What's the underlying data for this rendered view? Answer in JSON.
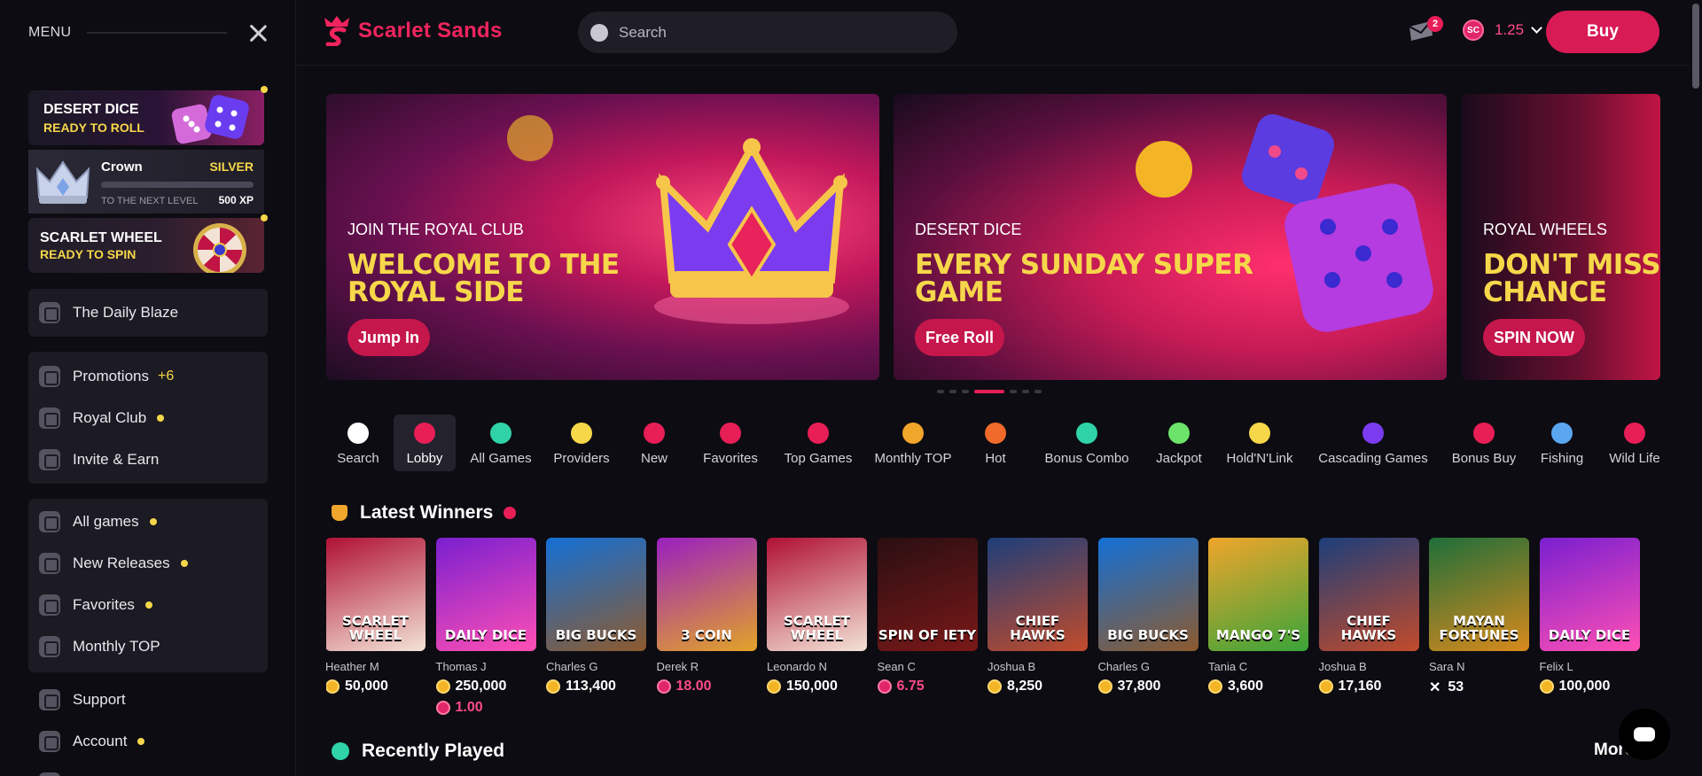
{
  "sidebar": {
    "menu_label": "MENU",
    "promos": {
      "dice": {
        "title": "DESERT DICE",
        "subtitle": "READY TO ROLL"
      },
      "crown": {
        "name": "Crown",
        "level": "SILVER",
        "next": "TO THE NEXT LEVEL",
        "xp": "500 XP",
        "progress": 0.0
      },
      "wheel": {
        "title": "SCARLET WHEEL",
        "subtitle": "READY TO SPIN"
      }
    },
    "daily": "The Daily Blaze",
    "group1": [
      {
        "label": "Promotions",
        "badge": "+6"
      },
      {
        "label": "Royal Club"
      },
      {
        "label": "Invite & Earn"
      }
    ],
    "group2": [
      {
        "label": "All games"
      },
      {
        "label": "New Releases"
      },
      {
        "label": "Favorites"
      },
      {
        "label": "Monthly TOP"
      }
    ],
    "support": "Support",
    "account": "Account"
  },
  "header": {
    "brand": "Scarlet Sands",
    "search_placeholder": "Search",
    "mail_count": "2",
    "currency_code": "SC",
    "balance": "1.25",
    "buy_label": "Buy"
  },
  "banners": [
    {
      "kicker": "JOIN THE ROYAL CLUB",
      "headline": "WELCOME TO THE ROYAL SIDE",
      "cta": "Jump In"
    },
    {
      "kicker": "DESERT DICE",
      "headline": "EVERY SUNDAY SUPER GAME",
      "cta": "Free Roll"
    },
    {
      "kicker": "ROYAL WHEELS",
      "headline": "DON'T MISS YOUR CHANCE",
      "cta": "SPIN NOW"
    }
  ],
  "categories": [
    {
      "label": "Search",
      "icon": "search-icon",
      "color": "#ffffff"
    },
    {
      "label": "Lobby",
      "icon": "lobby-icon",
      "color": "#e81e57"
    },
    {
      "label": "All Games",
      "icon": "gamepad-icon",
      "color": "#2fd3a7"
    },
    {
      "label": "Providers",
      "icon": "star-icon",
      "color": "#f6d74a"
    },
    {
      "label": "New",
      "icon": "new-icon",
      "color": "#e81e57"
    },
    {
      "label": "Favorites",
      "icon": "heart-icon",
      "color": "#e81e57"
    },
    {
      "label": "Top Games",
      "icon": "rocket-icon",
      "color": "#e81e57"
    },
    {
      "label": "Monthly TOP",
      "icon": "medal-icon",
      "color": "#f0a52b"
    },
    {
      "label": "Hot",
      "icon": "flame-icon",
      "color": "#f06a2b"
    },
    {
      "label": "Bonus Combo",
      "icon": "bomb-icon",
      "color": "#2fd3a7"
    },
    {
      "label": "Jackpot",
      "icon": "jackpot-icon",
      "color": "#6ce36a"
    },
    {
      "label": "Hold'N'Link",
      "icon": "coins-icon",
      "color": "#f6d74a"
    },
    {
      "label": "Cascading Games",
      "icon": "cascade-icon",
      "color": "#7b3cf0"
    },
    {
      "label": "Bonus Buy",
      "icon": "bag-icon",
      "color": "#e81e57"
    },
    {
      "label": "Fishing",
      "icon": "fish-icon",
      "color": "#5aa7f0"
    },
    {
      "label": "Wild Life",
      "icon": "wildlife-icon",
      "color": "#e81e57"
    }
  ],
  "latest_winners": {
    "title": "Latest Winners",
    "items": [
      {
        "game": "SCARLET WHEEL",
        "player": "Heather M",
        "prize": "50,000",
        "coin": "gold",
        "colorA": "#b01035",
        "colorB": "#f3e3d6"
      },
      {
        "game": "DAILY DICE",
        "player": "Thomas J",
        "prize": "250,000",
        "prize2": "1.00",
        "coin": "gold",
        "colorA": "#7a1fd0",
        "colorB": "#ff4fb4"
      },
      {
        "game": "BIG BUCKS",
        "player": "Charles G",
        "prize": "113,400",
        "coin": "gold",
        "colorA": "#1470d6",
        "colorB": "#8d5a2d"
      },
      {
        "game": "3 COIN",
        "player": "Derek R",
        "prize": "18.00",
        "coin": "sc",
        "colorA": "#9a1fc0",
        "colorB": "#e2a428"
      },
      {
        "game": "SCARLET WHEEL",
        "player": "Leonardo N",
        "prize": "150,000",
        "coin": "gold",
        "colorA": "#b01035",
        "colorB": "#f3e3d6"
      },
      {
        "game": "SPIN OF IETY",
        "player": "Sean C",
        "prize": "6.75",
        "coin": "sc",
        "colorA": "#2a0f12",
        "colorB": "#7a1818"
      },
      {
        "game": "CHIEF HAWKS",
        "player": "Joshua B",
        "prize": "8,250",
        "coin": "gold",
        "colorA": "#1d3e7a",
        "colorB": "#c24b2b"
      },
      {
        "game": "BIG BUCKS",
        "player": "Charles G",
        "prize": "37,800",
        "coin": "gold",
        "colorA": "#1470d6",
        "colorB": "#8d5a2d"
      },
      {
        "game": "MANGO 7'S",
        "player": "Tania C",
        "prize": "3,600",
        "coin": "gold",
        "colorA": "#f0a52b",
        "colorB": "#3aa43a"
      },
      {
        "game": "CHIEF HAWKS",
        "player": "Joshua B",
        "prize": "17,160",
        "coin": "gold",
        "colorA": "#1d3e7a",
        "colorB": "#c24b2b"
      },
      {
        "game": "MAYAN FORTUNES",
        "player": "Sara N",
        "prize": "53",
        "coin": "x",
        "colorA": "#1f6e3a",
        "colorB": "#d88a1c"
      },
      {
        "game": "DAILY DICE",
        "player": "Felix L",
        "prize": "100,000",
        "coin": "gold",
        "colorA": "#7a1fd0",
        "colorB": "#ff4fb4"
      }
    ]
  },
  "recently_played": {
    "title": "Recently Played",
    "more": "More"
  }
}
